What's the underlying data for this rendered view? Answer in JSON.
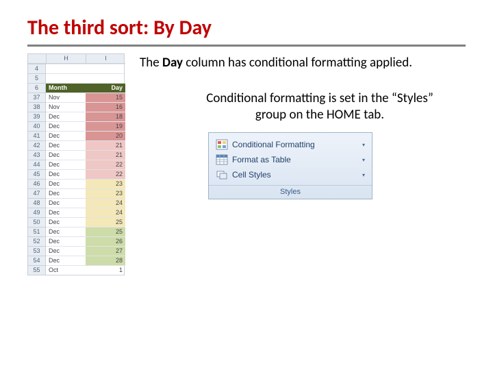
{
  "title": "The third sort: By Day",
  "caption1_pre": "The ",
  "caption1_bold": "Day",
  "caption1_post": " column has conditional formatting applied.",
  "caption2": "Conditional formatting is set in the “Styles” group on the HOME tab.",
  "sheet": {
    "cols": [
      "",
      "H",
      "I"
    ],
    "blank_rows": [
      "4",
      "5"
    ],
    "header_row": {
      "num": "6",
      "h": "Month",
      "i": "Day"
    },
    "rows": [
      {
        "num": "37",
        "month": "Nov",
        "day": "15",
        "cf": "cf-red"
      },
      {
        "num": "38",
        "month": "Nov",
        "day": "16",
        "cf": "cf-red"
      },
      {
        "num": "39",
        "month": "Dec",
        "day": "18",
        "cf": "cf-red"
      },
      {
        "num": "40",
        "month": "Dec",
        "day": "19",
        "cf": "cf-red"
      },
      {
        "num": "41",
        "month": "Dec",
        "day": "20",
        "cf": "cf-red"
      },
      {
        "num": "42",
        "month": "Dec",
        "day": "21",
        "cf": "cf-pink"
      },
      {
        "num": "43",
        "month": "Dec",
        "day": "21",
        "cf": "cf-pink"
      },
      {
        "num": "44",
        "month": "Dec",
        "day": "22",
        "cf": "cf-pink"
      },
      {
        "num": "45",
        "month": "Dec",
        "day": "22",
        "cf": "cf-pink"
      },
      {
        "num": "46",
        "month": "Dec",
        "day": "23",
        "cf": "cf-yel"
      },
      {
        "num": "47",
        "month": "Dec",
        "day": "23",
        "cf": "cf-yel"
      },
      {
        "num": "48",
        "month": "Dec",
        "day": "24",
        "cf": "cf-yel"
      },
      {
        "num": "49",
        "month": "Dec",
        "day": "24",
        "cf": "cf-yel"
      },
      {
        "num": "50",
        "month": "Dec",
        "day": "25",
        "cf": "cf-yel"
      },
      {
        "num": "51",
        "month": "Dec",
        "day": "25",
        "cf": "cf-grn"
      },
      {
        "num": "52",
        "month": "Dec",
        "day": "26",
        "cf": "cf-grn"
      },
      {
        "num": "53",
        "month": "Dec",
        "day": "27",
        "cf": "cf-grn"
      },
      {
        "num": "54",
        "month": "Dec",
        "day": "28",
        "cf": "cf-grn"
      },
      {
        "num": "55",
        "month": "Oct",
        "day": "1",
        "cf": ""
      }
    ]
  },
  "ribbon": {
    "items": [
      {
        "icon": "cf-icon",
        "label": "Conditional Formatting"
      },
      {
        "icon": "table-icon",
        "label": "Format as Table"
      },
      {
        "icon": "styles-icon",
        "label": "Cell Styles"
      }
    ],
    "group_label": "Styles"
  }
}
